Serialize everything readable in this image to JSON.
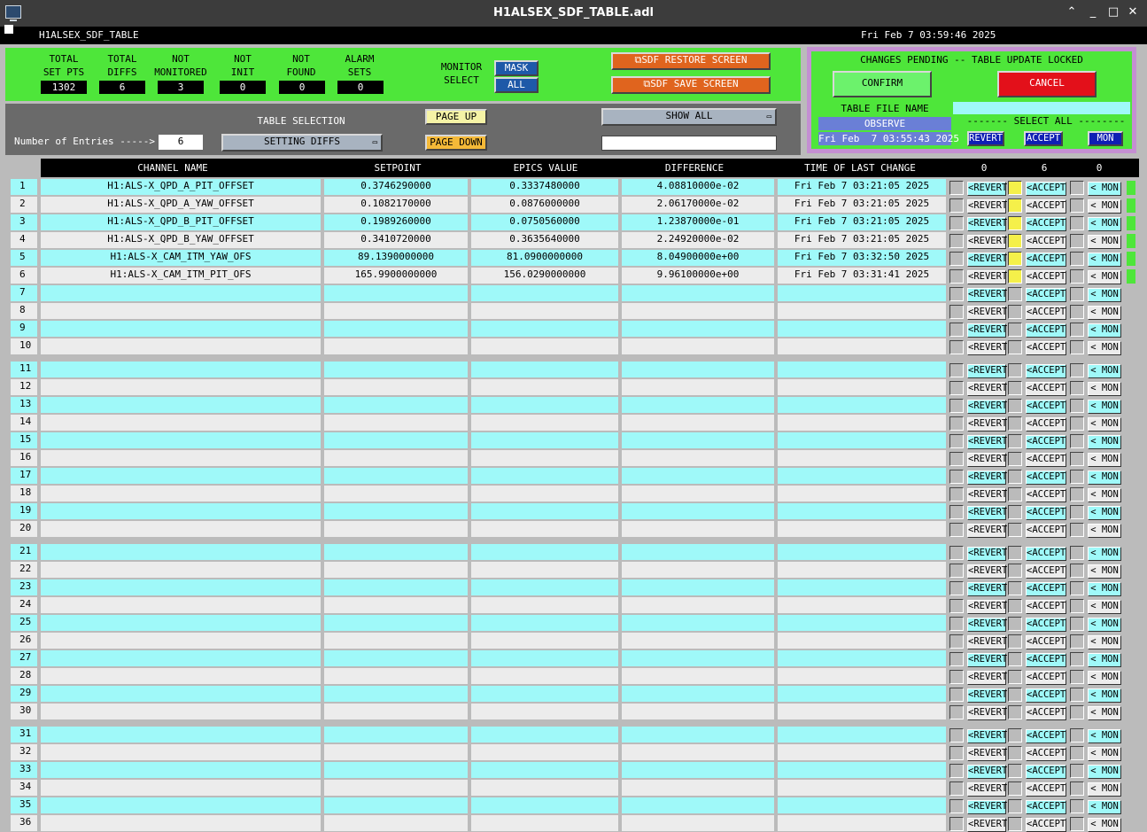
{
  "window": {
    "title": "H1ALSEX_SDF_TABLE.adl",
    "app_label": "H1ALSEX_SDF_TABLE",
    "clock": "Fri Feb  7 03:59:46 2025",
    "min_glyph": "⌃",
    "min2_glyph": "_",
    "max_glyph": "□",
    "close_glyph": "✕"
  },
  "stats": [
    {
      "label": "TOTAL\nSET PTS",
      "value": "1302"
    },
    {
      "label": "TOTAL\nDIFFS",
      "value": "6"
    },
    {
      "label": "NOT\nMONITORED",
      "value": "3"
    },
    {
      "label": "NOT\nINIT",
      "value": "0"
    },
    {
      "label": "NOT\nFOUND",
      "value": "0"
    },
    {
      "label": "ALARM\nSETS",
      "value": "0"
    }
  ],
  "monitor_select": {
    "label": "MONITOR\nSELECT",
    "mask": "MASK",
    "all": "ALL"
  },
  "screens": {
    "restore": "SDF RESTORE SCREEN",
    "save": "SDF SAVE SCREEN"
  },
  "pending": {
    "title": "CHANGES PENDING -- TABLE UPDATE LOCKED",
    "confirm": "CONFIRM",
    "cancel": "CANCEL",
    "file_label": "TABLE FILE NAME",
    "file_name": "",
    "observe": "OBSERVE",
    "timestamp": "Fri Feb  7 03:55:43 2025",
    "select_all": "------- SELECT ALL --------",
    "revert": "REVERT",
    "accept": "ACCEPT",
    "mon": "MON"
  },
  "controls": {
    "table_selection": "TABLE SELECTION",
    "setting_diffs": "SETTING DIFFS",
    "page_up": "PAGE UP",
    "page_down": "PAGE DOWN",
    "show_all": "SHOW ALL",
    "entries_label": "Number of Entries ----->",
    "entries_value": "6",
    "filter_value": ""
  },
  "columns": {
    "channel": "CHANNEL NAME",
    "setpoint": "SETPOINT",
    "epics": "EPICS VALUE",
    "difference": "DIFFERENCE",
    "time": "TIME OF LAST CHANGE",
    "count_revert": "0",
    "count_accept": "6",
    "count_mon": "0"
  },
  "row_buttons": {
    "revert": "<REVERT",
    "accept": "<ACCEPT",
    "mon": "< MON"
  },
  "rows": [
    {
      "channel": "H1:ALS-X_QPD_A_PIT_OFFSET",
      "setpoint": "0.3746290000",
      "epics": "0.3337480000",
      "diff": "4.08810000e-02",
      "time": "Fri Feb  7 03:21:05 2025"
    },
    {
      "channel": "H1:ALS-X_QPD_A_YAW_OFFSET",
      "setpoint": "0.1082170000",
      "epics": "0.0876000000",
      "diff": "2.06170000e-02",
      "time": "Fri Feb  7 03:21:05 2025"
    },
    {
      "channel": "H1:ALS-X_QPD_B_PIT_OFFSET",
      "setpoint": "0.1989260000",
      "epics": "0.0750560000",
      "diff": "1.23870000e-01",
      "time": "Fri Feb  7 03:21:05 2025"
    },
    {
      "channel": "H1:ALS-X_QPD_B_YAW_OFFSET",
      "setpoint": "0.3410720000",
      "epics": "0.3635640000",
      "diff": "2.24920000e-02",
      "time": "Fri Feb  7 03:21:05 2025"
    },
    {
      "channel": "H1:ALS-X_CAM_ITM_YAW_OFS",
      "setpoint": "89.1390000000",
      "epics": "81.0900000000",
      "diff": "8.04900000e+00",
      "time": "Fri Feb  7 03:32:50 2025"
    },
    {
      "channel": "H1:ALS-X_CAM_ITM_PIT_OFS",
      "setpoint": "165.9900000000",
      "epics": "156.0290000000",
      "diff": "9.96100000e+00",
      "time": "Fri Feb  7 03:31:41 2025"
    }
  ],
  "row_numbers": [
    "1",
    "2",
    "3",
    "4",
    "5",
    "6",
    "7",
    "8",
    "9",
    "10",
    "11",
    "12",
    "13",
    "14",
    "15",
    "16",
    "17",
    "18",
    "19",
    "20",
    "21",
    "22",
    "23",
    "24",
    "25",
    "26",
    "27",
    "28",
    "29",
    "30",
    "31",
    "32",
    "33",
    "34",
    "35",
    "36"
  ],
  "colors": {
    "green": "#4ee63a",
    "cyan": "#9ff9f9",
    "light": "#ececec",
    "yellow": "#f5f04a",
    "blue": "#1e59a8",
    "orange": "#e0641e",
    "confirm": "#6cf26c",
    "cancel": "#e3101a"
  }
}
